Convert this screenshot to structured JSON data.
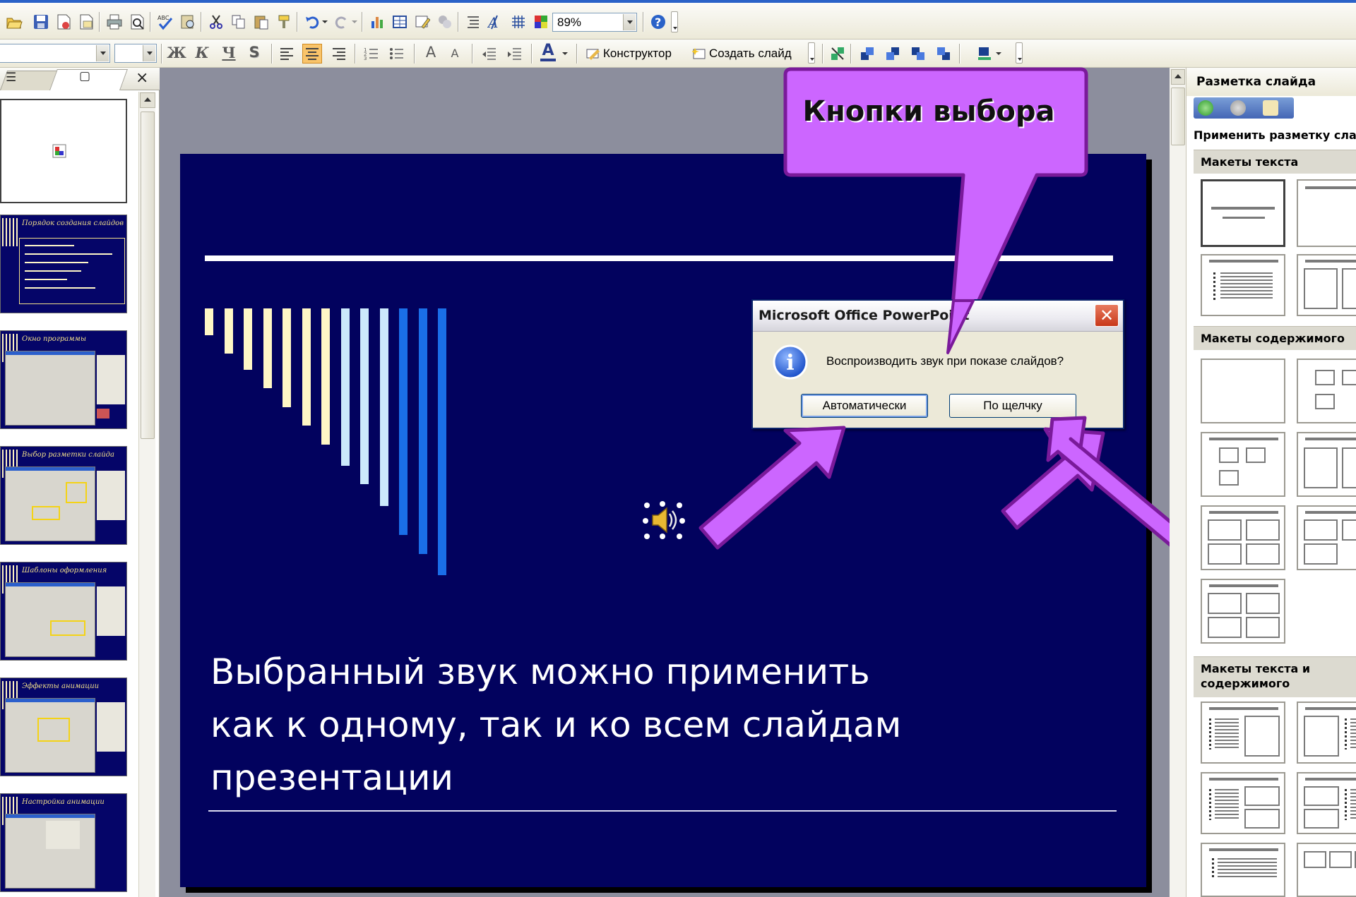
{
  "toolbar": {
    "zoom_value": "89%",
    "font_name_value": "",
    "font_size_value": "",
    "designer_label": "Конструктор",
    "new_slide_label": "Создать слайд",
    "bold_glyph": "Ж",
    "italic_glyph": "К",
    "underline_glyph": "Ч",
    "shadow_glyph": "S",
    "font_color_glyph": "A",
    "grow_font_glyph": "A",
    "shrink_font_glyph": "A",
    "icons": [
      "open-icon",
      "save-icon",
      "permission-icon",
      "email-icon",
      "print-icon",
      "print-preview-icon",
      "spelling-icon",
      "research-icon",
      "cut-icon",
      "copy-icon",
      "paste-icon",
      "format-painter-icon",
      "undo-icon",
      "redo-icon",
      "insert-chart-icon",
      "insert-table-icon",
      "tables-borders-icon",
      "insert-diagram-icon",
      "expand-all-icon",
      "show-formatting-icon",
      "show-grid-icon",
      "color-grayscale-icon",
      "help-icon"
    ]
  },
  "thumbnails": {
    "close_glyph": "×",
    "slide_titles": [
      "",
      "Порядок создания слайдов",
      "Окно программы",
      "Выбор разметки слайда",
      "Шаблоны оформления",
      "Эффекты анимации",
      "Настройка анимации"
    ]
  },
  "slide": {
    "body_lines": [
      "Выбранный звук можно применить",
      "как к одному, так и ко всем слайдам",
      "презентации"
    ],
    "bar_colors": [
      "#fff7c6",
      "#fff7c6",
      "#fff7c6",
      "#fff7c6",
      "#fff7c6",
      "#fff7c6",
      "#fff7c6",
      "#cbe9fb",
      "#cbe9fb",
      "#cbe9fb",
      "#1a6ee8",
      "#1a6ee8",
      "#1a6ee8"
    ],
    "bar_levels": [
      0.1,
      0.17,
      0.23,
      0.3,
      0.37,
      0.44,
      0.51,
      0.59,
      0.66,
      0.74,
      0.85,
      0.92,
      1.0
    ]
  },
  "dialog": {
    "title": "Microsoft Office PowerPoint",
    "close_glyph": "✕",
    "info_glyph": "i",
    "message": "Воспроизводить звук при показе слайдов?",
    "buttons": [
      "Автоматически",
      "По щелчку"
    ]
  },
  "callout": {
    "text": "Кнопки выбора",
    "fill": "#cc66ff",
    "stroke": "#7a1a9a"
  },
  "task_pane": {
    "title": "Разметка слайда",
    "apply_label": "Применить разметку слайда:",
    "groups": [
      "Макеты текста",
      "Макеты содержимого",
      "Макеты текста и содержимого"
    ]
  },
  "colors": {
    "slide_background": "#02025e",
    "window_workspace": "#8c8e9d",
    "xp_title_blue": "#2a62c8"
  }
}
